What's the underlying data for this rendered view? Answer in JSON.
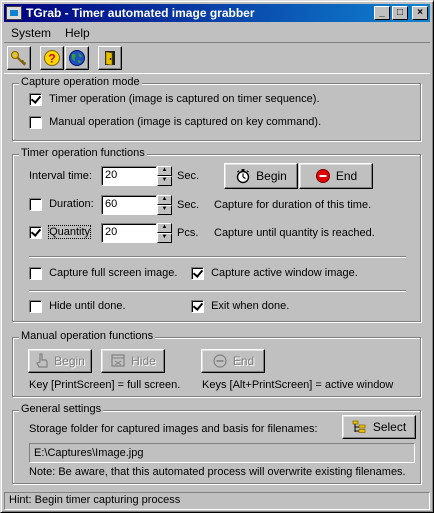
{
  "window": {
    "title": "TGrab - Timer automated image grabber",
    "minimize_glyph": "_",
    "maximize_glyph": "□",
    "close_glyph": "×"
  },
  "menu": {
    "system": "System",
    "help": "Help"
  },
  "toolbar": {
    "icons": [
      "key-icon",
      "help-question-icon",
      "globe-icon",
      "exit-door-icon"
    ]
  },
  "capture_mode": {
    "legend": "Capture operation mode",
    "timer_label": "Timer operation (image is captured on timer sequence).",
    "timer_checked": true,
    "manual_label": "Manual operation (image is captured on key command).",
    "manual_checked": false
  },
  "timer_functions": {
    "legend": "Timer operation functions",
    "interval_label": "Interval time:",
    "interval_value": "20",
    "interval_unit": "Sec.",
    "begin_label": "Begin",
    "end_label": "End",
    "duration_label": "Duration:",
    "duration_checked": false,
    "duration_value": "60",
    "duration_unit": "Sec.",
    "duration_hint": "Capture for duration of this time.",
    "quantity_label": "Quantity",
    "quantity_checked": true,
    "quantity_value": "20",
    "quantity_unit": "Pcs.",
    "quantity_hint": "Capture until quantity is reached.",
    "full_screen_label": "Capture full screen image.",
    "full_screen_checked": false,
    "active_window_label": "Capture active window image.",
    "active_window_checked": true,
    "hide_label": "Hide until done.",
    "hide_checked": false,
    "exit_label": "Exit when done.",
    "exit_checked": true
  },
  "manual_functions": {
    "legend": "Manual operation functions",
    "begin_label": "Begin",
    "hide_label": "Hide",
    "end_label": "End",
    "key_full": "Key [PrintScreen] = full screen.",
    "key_active": "Keys [Alt+PrintScreen] = active window"
  },
  "general": {
    "legend": "General settings",
    "storage_label": "Storage folder for captured images and basis for filenames:",
    "select_label": "Select",
    "path_value": "E:\\Captures\\Image.jpg",
    "note": "Note: Be aware, that this automated process will overwrite existing filenames."
  },
  "status": {
    "hint": "Hint: Begin timer capturing process"
  }
}
